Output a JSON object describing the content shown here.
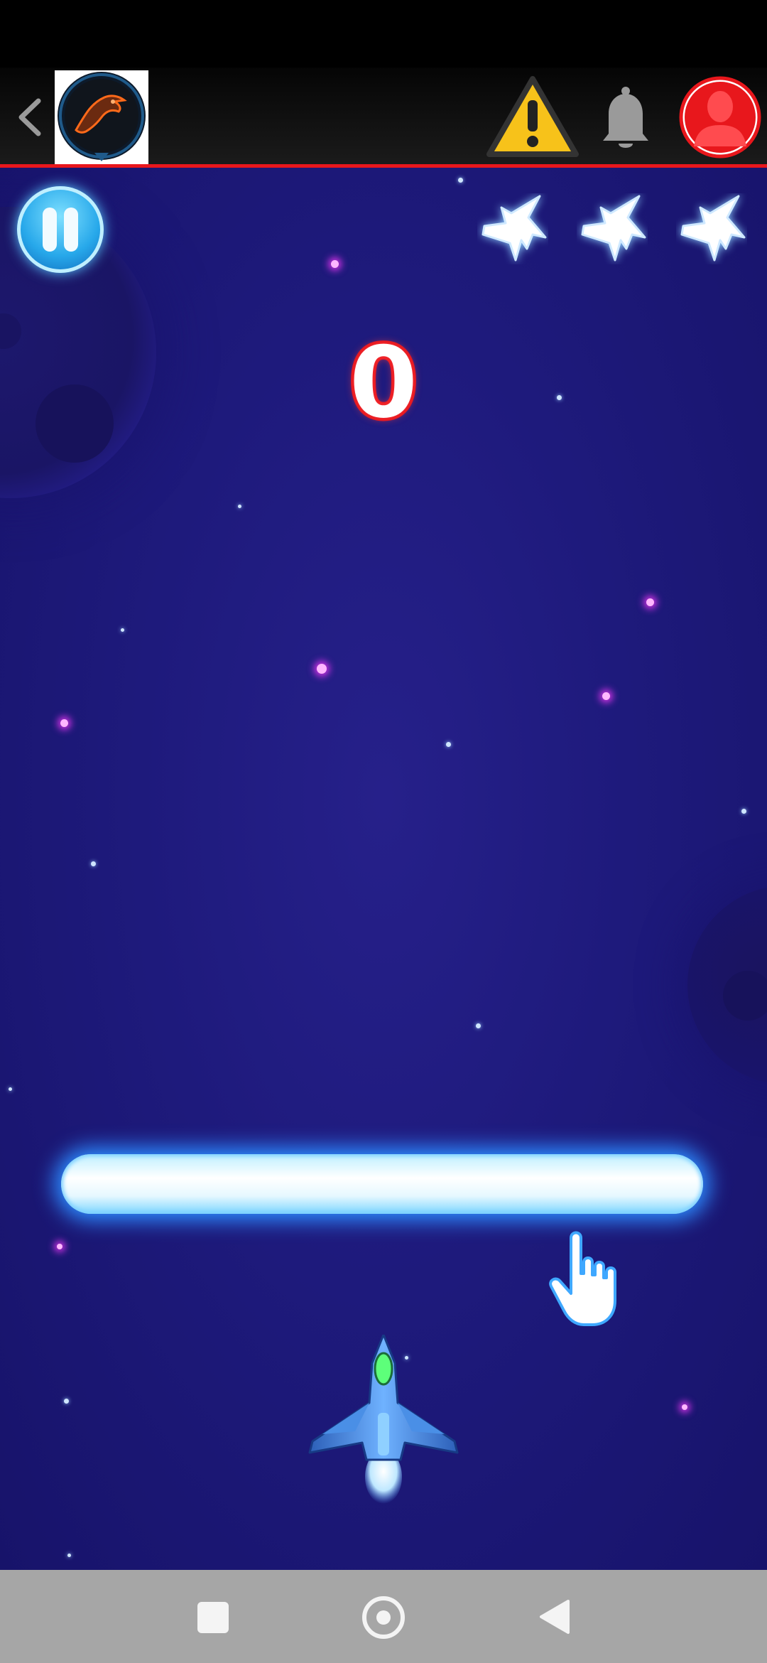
{
  "header": {
    "back_icon": "chevron-left-icon",
    "logo_icon": "eagle-emblem-icon",
    "warning_icon": "warning-triangle-icon",
    "bell_icon": "bell-icon",
    "profile_icon": "user-avatar-icon",
    "accent_color": "#e8171c"
  },
  "game": {
    "score": "0",
    "lives_remaining": 3,
    "pause_icon": "pause-icon",
    "life_icon": "jet-silhouette-icon",
    "hint_icon": "hand-pointer-icon",
    "player_icon": "spaceship-icon",
    "background_color": "#1e1a7c"
  },
  "nav": {
    "recents_icon": "square-icon",
    "home_icon": "circle-icon",
    "back_icon": "triangle-back-icon"
  }
}
